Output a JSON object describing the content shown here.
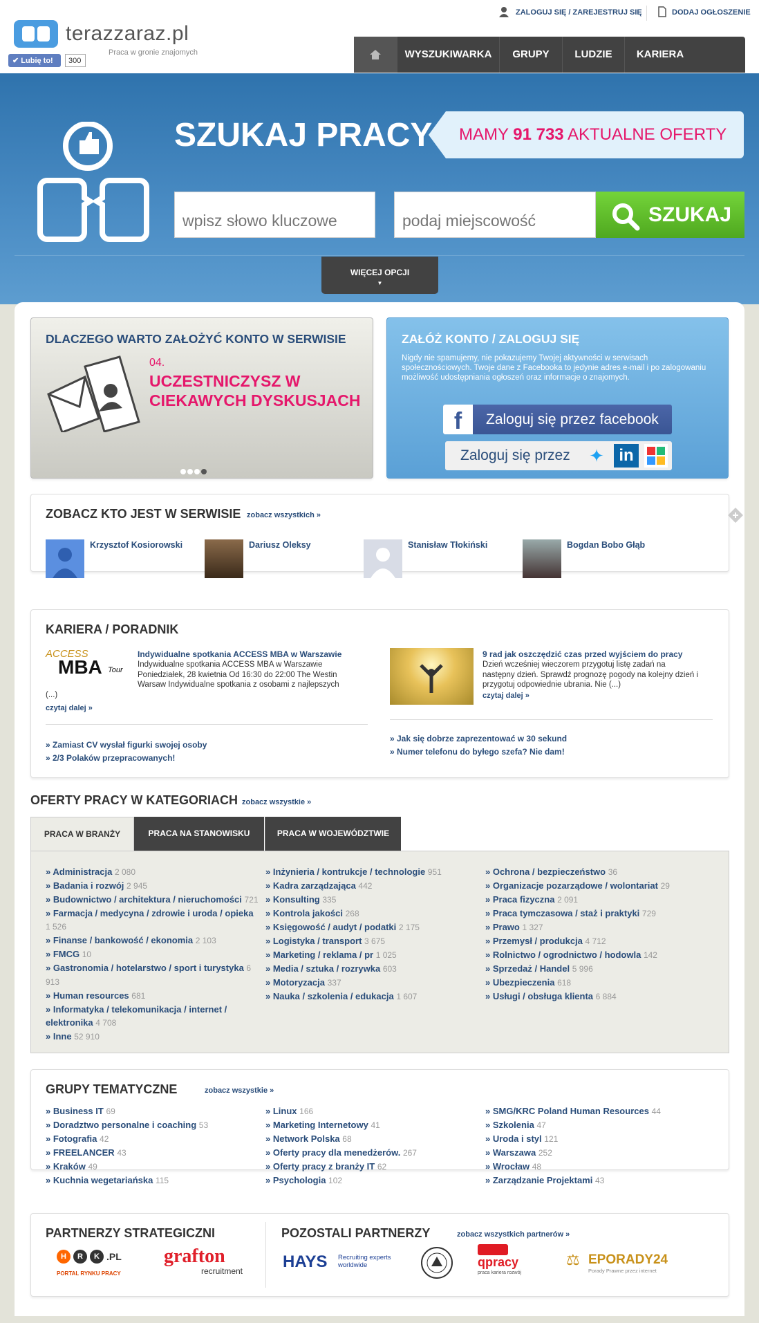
{
  "site": {
    "name": "terazzaraz.pl",
    "tagline": "Praca w gronie znajomych",
    "like_label": "Lubię to!",
    "like_count": "300"
  },
  "toplinks": {
    "login": "ZALOGUJ SIĘ / ZAREJESTRUJ SIĘ",
    "add_ad": "DODAJ OGŁOSZENIE"
  },
  "nav": [
    "WYSZUKIWARKA OFERT",
    "GRUPY",
    "LUDZIE",
    "KARIERA"
  ],
  "hero": {
    "title": "SZUKAJ PRACY",
    "banner_pre": "MAMY ",
    "banner_num": "91 733",
    "banner_post": " AKTUALNE OFERTY",
    "keyword_placeholder": "wpisz słowo kluczowe",
    "location_placeholder": "podaj miejscowość",
    "search_label": "SZUKAJ",
    "more_options": "WIĘCEJ OPCJI"
  },
  "why": {
    "title": "DLACZEGO WARTO ZAŁOŻYĆ KONTO W SERWISIE",
    "num": "04.",
    "line1": "UCZESTNICZYSZ W",
    "line2": "CIEKAWYCH DYSKUSJACH"
  },
  "account": {
    "title": "ZAŁÓŻ KONTO / ZALOGUJ SIĘ",
    "text": "Nigdy nie spamujemy, nie pokazujemy Twojej aktywności w serwisach społecznościowych. Twoje dane z Facebooka to jedynie adres e-mail i po zalogowaniu możliwość udostępniania ogłoszeń oraz informacje o znajomych.",
    "fb": "Zaloguj się przez facebook",
    "other": "Zaloguj się przez"
  },
  "people": {
    "title": "ZOBACZ KTO JEST W SERWISIE",
    "more": "zobacz wszystkich »",
    "list": [
      "Krzysztof Kosiorowski",
      "Dariusz Oleksy",
      "Stanisław Tłokiński",
      "Bogdan Bobo Głąb"
    ]
  },
  "career": {
    "title": "KARIERA / PORADNIK",
    "a1": {
      "title": "Indywidualne spotkania ACCESS MBA w Warszawie",
      "l1": "Indywidualne spotkania ACCESS MBA w Warszawie",
      "l2": "Poniedziałek, 28 kwietnia Od 16:30 do 22:00 The Westin",
      "l3": "Warsaw   Indywidualne spotkania z osobami z najlepszych",
      "l4": "(...)",
      "more": "czytaj dalej »",
      "logo_top": "ACCESS",
      "logo_main": "MBA",
      "logo_tour": "Tour"
    },
    "a2": {
      "title": "9 rad jak oszczędzić czas przed wyjściem do pracy",
      "l1": " Dzień wcześniej wieczorem przygotuj listę zadań na",
      "l2": "następny dzień. Sprawdź prognozę pogody na kolejny dzień i",
      "l3": "przygotuj odpowiednie ubrania. Nie (...)",
      "more": "czytaj dalej »"
    },
    "links_left": [
      "» Zamiast CV wysłał figurki swojej osoby",
      "» 2/3 Polaków przepracowanych!"
    ],
    "links_right": [
      "» Jak się dobrze zaprezentować w 30 sekund",
      "» Numer telefonu do byłego szefa? Nie dam!"
    ]
  },
  "offers": {
    "title": "OFERTY PRACY W KATEGORIACH",
    "more": "zobacz wszystkie »",
    "tabs": [
      "PRACA W BRANŻY",
      "PRACA NA STANOWISKU",
      "PRACA W WOJEWÓDZTWIE"
    ],
    "col1": [
      [
        "» Administracja",
        "2 080"
      ],
      [
        "» Badania i rozwój",
        "2 945"
      ],
      [
        "» Budownictwo / architektura / nieruchomości",
        "721"
      ],
      [
        "» Farmacja / medycyna / zdrowie i uroda / opieka",
        "1 526"
      ],
      [
        "» Finanse / bankowość / ekonomia",
        "2 103"
      ],
      [
        "» FMCG",
        "10"
      ],
      [
        "» Gastronomia / hotelarstwo / sport i turystyka",
        "6 913"
      ],
      [
        "» Human resources",
        "681"
      ],
      [
        "» Informatyka / telekomunikacja / internet / elektronika",
        "4 708"
      ],
      [
        "» Inne",
        "52 910"
      ]
    ],
    "col2": [
      [
        "» Inżynieria / kontrukcje / technologie",
        "951"
      ],
      [
        "» Kadra zarządzająca",
        "442"
      ],
      [
        "» Konsulting",
        "335"
      ],
      [
        "» Kontrola jakości",
        "268"
      ],
      [
        "» Księgowość / audyt / podatki",
        "2 175"
      ],
      [
        "» Logistyka / transport",
        "3 675"
      ],
      [
        "» Marketing / reklama / pr",
        "1 025"
      ],
      [
        "» Media / sztuka / rozrywka",
        "603"
      ],
      [
        "» Motoryzacja",
        "337"
      ],
      [
        "» Nauka / szkolenia / edukacja",
        "1 607"
      ]
    ],
    "col3": [
      [
        "» Ochrona / bezpieczeństwo",
        "36"
      ],
      [
        "» Organizacje pozarządowe / wolontariat",
        "29"
      ],
      [
        "» Praca fizyczna",
        "2 091"
      ],
      [
        "» Praca tymczasowa / staż i praktyki",
        "729"
      ],
      [
        "» Prawo",
        "1 327"
      ],
      [
        "» Przemysł / produkcja",
        "4 712"
      ],
      [
        "» Rolnictwo / ogrodnictwo / hodowla",
        "142"
      ],
      [
        "» Sprzedaż / Handel",
        "5 996"
      ],
      [
        "» Ubezpieczenia",
        "618"
      ],
      [
        "» Usługi / obsługa klienta",
        "6 884"
      ]
    ]
  },
  "groups": {
    "title": "GRUPY TEMATYCZNE",
    "more": "zobacz wszystkie »",
    "col1": [
      [
        "» Business IT",
        "69"
      ],
      [
        "» Doradztwo personalne i coaching",
        "53"
      ],
      [
        "» Fotografia",
        "42"
      ],
      [
        "» FREELANCER",
        "43"
      ],
      [
        "» Kraków",
        "49"
      ],
      [
        "» Kuchnia wegetariańska",
        "115"
      ]
    ],
    "col2": [
      [
        "» Linux",
        "166"
      ],
      [
        "» Marketing Internetowy",
        "41"
      ],
      [
        "» Network Polska",
        "68"
      ],
      [
        "» Oferty pracy dla menedżerów.",
        "267"
      ],
      [
        "» Oferty pracy z branży IT",
        "62"
      ],
      [
        "» Psychologia",
        "102"
      ]
    ],
    "col3": [
      [
        "» SMG/KRC Poland Human Resources",
        "44"
      ],
      [
        "» Szkolenia",
        "47"
      ],
      [
        "» Uroda i styl",
        "121"
      ],
      [
        "» Warszawa",
        "252"
      ],
      [
        "» Wrocław",
        "48"
      ],
      [
        "» Zarządzanie Projektami",
        "43"
      ]
    ]
  },
  "partners": {
    "strategic": "PARTNERZY STRATEGICZNI",
    "other": "POZOSTALI PARTNERZY",
    "more": "zobacz wszystkich partnerów »",
    "hrk_sub": "PORTAL RYNKU PRACY",
    "grafton": "grafton",
    "grafton_sub": "recruitment",
    "hays": "HAYS",
    "hays_sub1": "Recruiting experts",
    "hays_sub2": "worldwide",
    "qpracy": "qpracy",
    "qpracy_sub": "praca kariera rozwój",
    "eporady": "EPORADY24",
    "eporady_sub": "Porady Prawne przez internet"
  }
}
